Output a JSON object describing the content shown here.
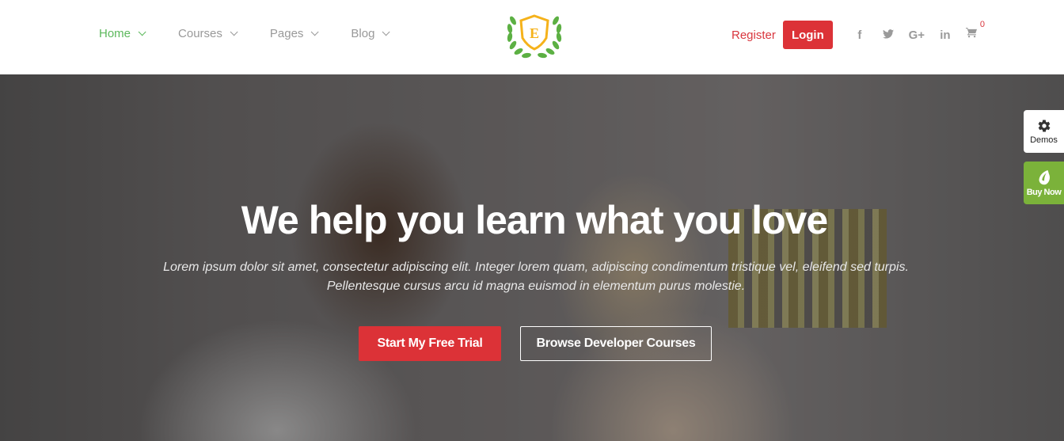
{
  "header": {
    "nav": [
      {
        "label": "Home",
        "active": true
      },
      {
        "label": "Courses",
        "active": false
      },
      {
        "label": "Pages",
        "active": false
      },
      {
        "label": "Blog",
        "active": false
      }
    ],
    "logo_letter": "E",
    "register_label": "Register",
    "login_label": "Login",
    "social": [
      {
        "icon": "facebook-icon",
        "glyph": "f"
      },
      {
        "icon": "twitter-icon",
        "glyph": "🐦"
      },
      {
        "icon": "google-plus-icon",
        "glyph": "G+"
      },
      {
        "icon": "linkedin-icon",
        "glyph": "in"
      }
    ],
    "cart_count": "0"
  },
  "hero": {
    "title": "We help you learn what you love",
    "subtitle_line1": "Lorem ipsum dolor sit amet, consectetur adipiscing elit. Integer lorem quam, adipiscing condimentum tristique vel, eleifend sed turpis.",
    "subtitle_line2": "Pellentesque cursus arcu id magna euismod in elementum purus molestie.",
    "primary_button": "Start My Free Trial",
    "secondary_button": "Browse Developer Courses"
  },
  "side_panel": {
    "demos_label": "Demos",
    "buy_label": "Buy Now"
  },
  "colors": {
    "accent_green": "#5cb85c",
    "accent_red": "#dc3237",
    "buy_green": "#7bb23a",
    "logo_gold": "#f5b21b"
  }
}
